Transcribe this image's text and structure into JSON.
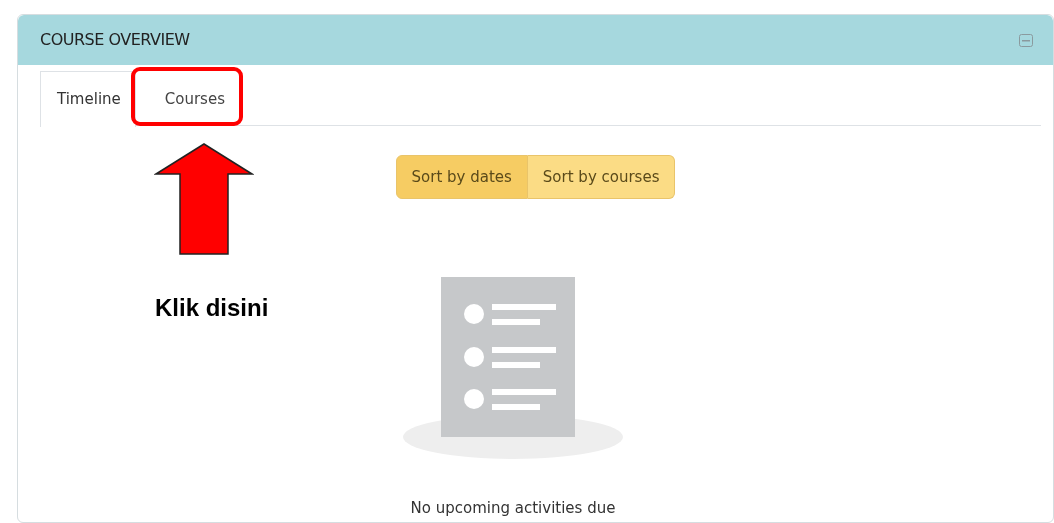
{
  "panel": {
    "title": "COURSE OVERVIEW"
  },
  "tabs": [
    {
      "label": "Timeline",
      "selected": true,
      "highlighted": false
    },
    {
      "label": "Courses",
      "selected": false,
      "highlighted": true
    }
  ],
  "sort_buttons": [
    {
      "label": "Sort by dates",
      "selected": true
    },
    {
      "label": "Sort by courses",
      "selected": false
    }
  ],
  "empty_state": {
    "message": "No upcoming activities due"
  },
  "annotation": {
    "text": "Klik disini"
  }
}
